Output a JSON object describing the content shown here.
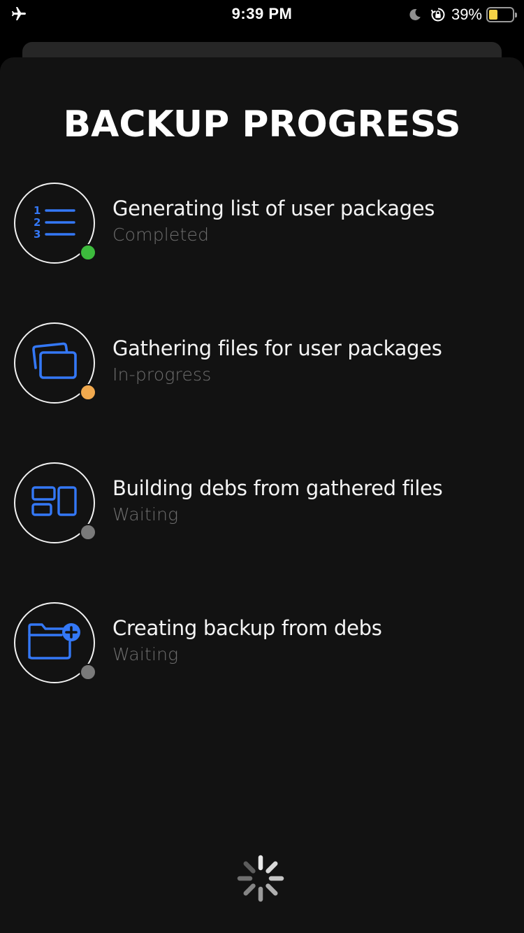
{
  "status_bar": {
    "time": "9:39 PM",
    "battery_percent": "39%",
    "battery_level": 0.39,
    "left_icon": "airplane-icon",
    "right_icons": [
      "moon-icon",
      "orientation-lock-icon",
      "battery-icon"
    ]
  },
  "page": {
    "title": "BACKUP PROGRESS"
  },
  "steps": [
    {
      "title": "Generating list of user packages",
      "status": "Completed",
      "icon": "numbered-list-icon",
      "status_color": "#3dbb3d"
    },
    {
      "title": "Gathering files for user packages",
      "status": "In-progress",
      "icon": "stacked-windows-icon",
      "status_color": "#f1a94e"
    },
    {
      "title": "Building debs from gathered files",
      "status": "Waiting",
      "icon": "grid-blocks-icon",
      "status_color": "#7a7a7a"
    },
    {
      "title": "Creating backup from debs",
      "status": "Waiting",
      "icon": "folder-plus-icon",
      "status_color": "#7a7a7a"
    }
  ],
  "colors": {
    "accent": "#3478f6",
    "background": "#121212"
  },
  "loading_indicator": "activity-spinner-icon"
}
